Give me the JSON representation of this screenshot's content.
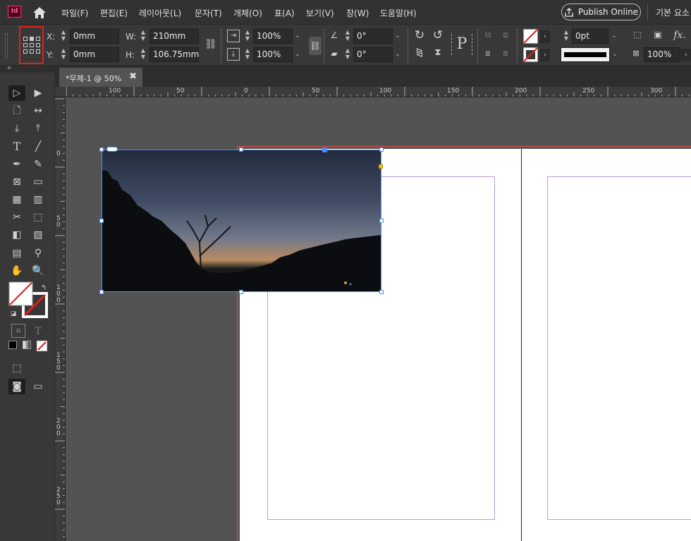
{
  "menubar": {
    "logo_text": "Id",
    "items": [
      "파일(F)",
      "편집(E)",
      "레이아웃(L)",
      "문자(T)",
      "개체(O)",
      "표(A)",
      "보기(V)",
      "창(W)",
      "도움말(H)"
    ],
    "publish_label": "Publish Online",
    "workspace_label": "기본 요소"
  },
  "control": {
    "x_label": "X:",
    "y_label": "Y:",
    "w_label": "W:",
    "h_label": "H:",
    "x_value": "0mm",
    "y_value": "0mm",
    "w_value": "210mm",
    "h_value": "106.75mm",
    "scale_x": "100%",
    "scale_y": "100%",
    "rotation": "0°",
    "shear": "0°",
    "stroke_weight": "0pt",
    "opacity": "100%",
    "text_wrap_glyph": "P",
    "fx_label": "fx."
  },
  "document": {
    "tab_label": "*무제-1 @ 50%",
    "close_glyph": "✖"
  },
  "ruler": {
    "h_labels": [
      "100",
      "50",
      "0",
      "50",
      "100",
      "150",
      "200",
      "250",
      "300"
    ],
    "v_labels": [
      "0",
      "50",
      "100",
      "150",
      "200",
      "250"
    ]
  },
  "colors": {
    "accent": "#4d8ef0",
    "bleed": "#e84c4c",
    "margin": "#b39ddb",
    "highlight": "#e02020"
  }
}
